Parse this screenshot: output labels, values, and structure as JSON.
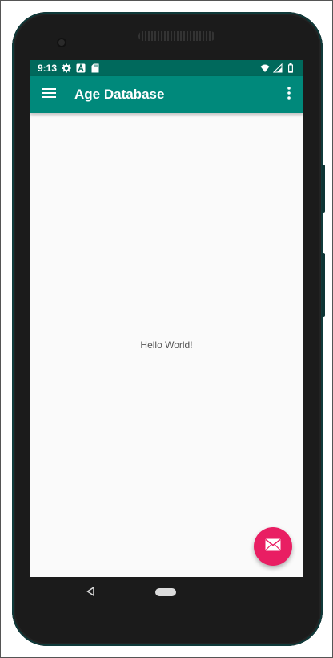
{
  "status_bar": {
    "time": "9:13",
    "left_icons": [
      "gear-icon",
      "android-a-icon",
      "sd-card-icon"
    ],
    "right_icons": [
      "wifi-icon",
      "cell-signal-icon",
      "battery-icon"
    ]
  },
  "app_bar": {
    "title": "Age Database",
    "menu_icon": "hamburger-menu-icon",
    "overflow_icon": "more-vert-icon"
  },
  "content": {
    "text": "Hello World!"
  },
  "fab": {
    "icon": "email-icon",
    "color": "#e91e63"
  },
  "navigation_bar": {
    "buttons": [
      "back-icon",
      "home-pill"
    ]
  },
  "colors": {
    "status_bar": "#00695c",
    "app_bar": "#00897b",
    "background": "#fafafa",
    "device": "#1b1b1b"
  }
}
